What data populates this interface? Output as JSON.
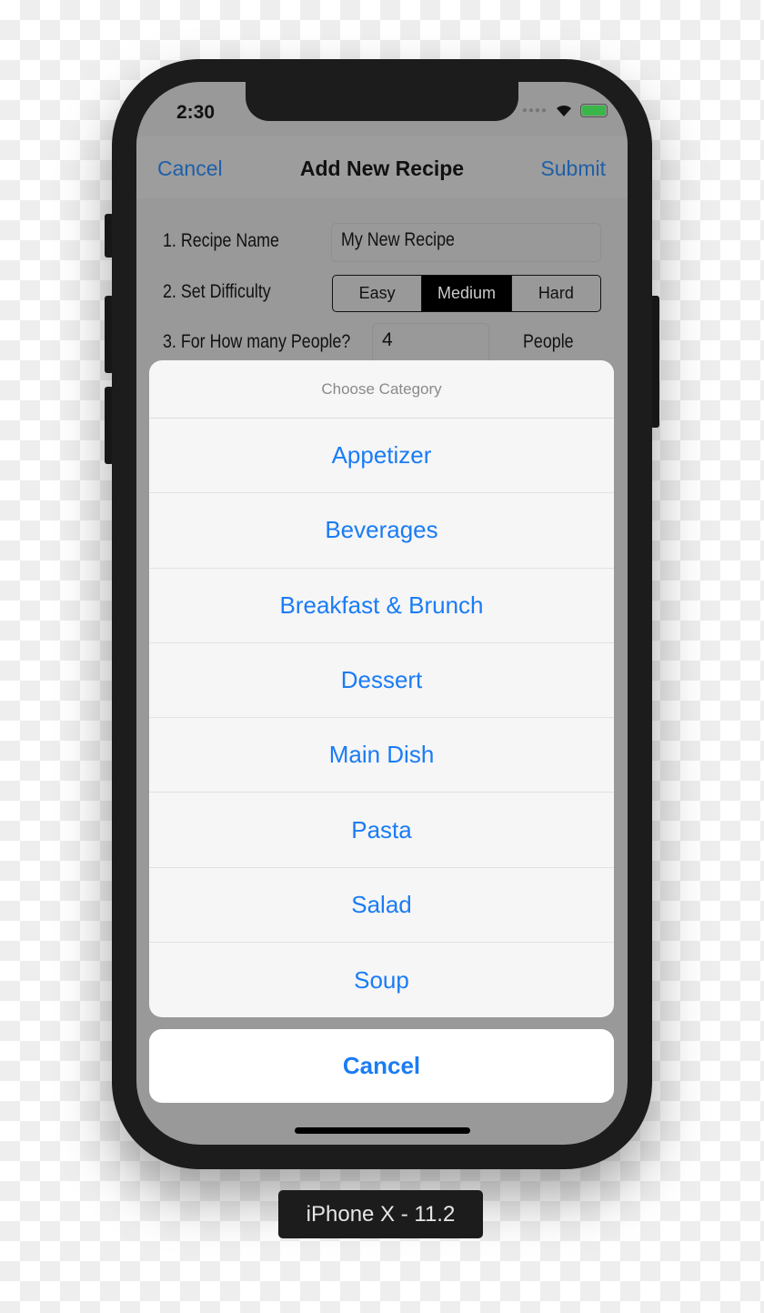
{
  "status_bar": {
    "time": "2:30",
    "icons": [
      "signal-dots-icon",
      "wifi-icon",
      "battery-charging-icon"
    ]
  },
  "nav": {
    "cancel": "Cancel",
    "title": "Add New Recipe",
    "submit": "Submit"
  },
  "form": {
    "recipe_name_label": "1. Recipe Name",
    "recipe_name_value": "My New Recipe",
    "difficulty_label": "2. Set Difficulty",
    "difficulty_options": [
      "Easy",
      "Medium",
      "Hard"
    ],
    "difficulty_selected": "Medium",
    "people_label": "3. For How many People?",
    "people_value": "4",
    "people_unit": "People"
  },
  "action_sheet": {
    "title": "Choose Category",
    "items": [
      "Appetizer",
      "Beverages",
      "Breakfast & Brunch",
      "Dessert",
      "Main Dish",
      "Pasta",
      "Salad",
      "Soup"
    ],
    "cancel": "Cancel"
  },
  "device_label": "iPhone X - 11.2",
  "colors": {
    "accent": "#1a7cf5",
    "battery": "#3ab54a"
  }
}
